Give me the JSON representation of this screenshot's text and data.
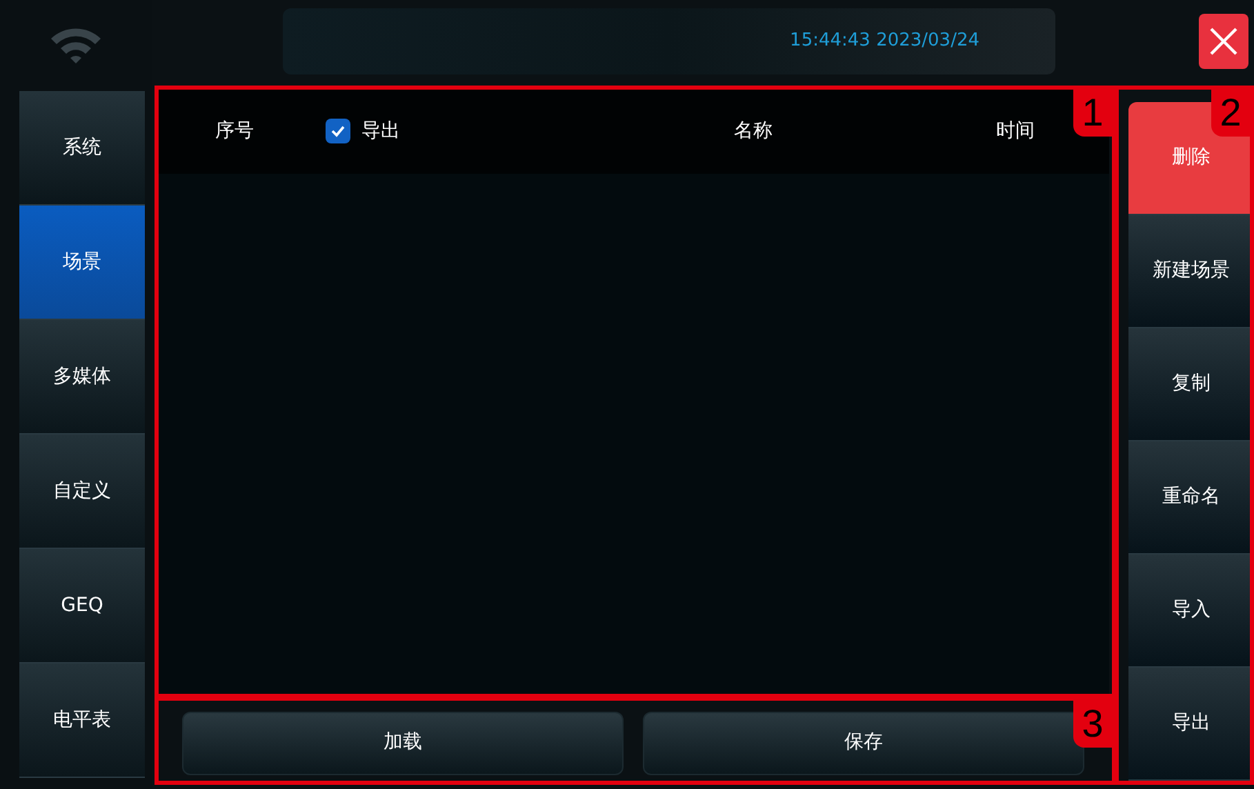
{
  "status": {
    "clock": "15:44:43 2023/03/24"
  },
  "nav": [
    {
      "label": "系统",
      "selected": false
    },
    {
      "label": "场景",
      "selected": true
    },
    {
      "label": "多媒体",
      "selected": false
    },
    {
      "label": "自定义",
      "selected": false
    },
    {
      "label": "GEQ",
      "selected": false
    },
    {
      "label": "电平表",
      "selected": false
    }
  ],
  "table": {
    "columns": [
      {
        "label": "序号",
        "kind": "text"
      },
      {
        "label": "导出",
        "kind": "checkbox",
        "checked": true
      },
      {
        "label": "名称",
        "kind": "text"
      },
      {
        "label": "时间",
        "kind": "text"
      }
    ]
  },
  "actions": [
    {
      "label": "删除",
      "selected": true
    },
    {
      "label": "新建场景",
      "selected": false
    },
    {
      "label": "复制",
      "selected": false
    },
    {
      "label": "重命名",
      "selected": false
    },
    {
      "label": "导入",
      "selected": false
    },
    {
      "label": "导出",
      "selected": false
    }
  ],
  "bottom_buttons": [
    "加载",
    "保存"
  ],
  "callouts": [
    {
      "label": "1",
      "kind": "table"
    },
    {
      "label": "2",
      "kind": "actions"
    },
    {
      "label": "3",
      "kind": "bottom"
    }
  ]
}
